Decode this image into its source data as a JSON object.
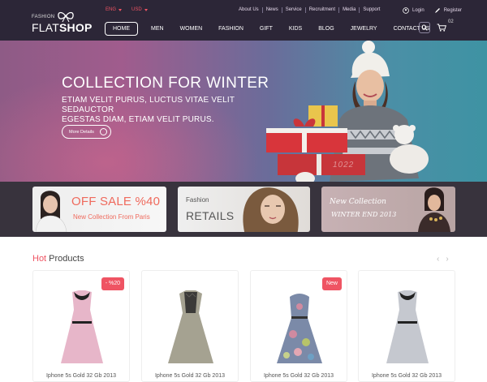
{
  "header": {
    "logo": {
      "small": "FASHION",
      "main_light": "FLAT",
      "main_bold": "SHOP"
    },
    "language": "ENG",
    "currency": "USD",
    "top_links": [
      "About Us",
      "News",
      "Service",
      "Recruitment",
      "Media",
      "Support"
    ],
    "account": {
      "login": "Login",
      "register": "Register"
    },
    "nav": [
      "HOME",
      "MEN",
      "WOMEN",
      "FASHION",
      "GIFT",
      "KIDS",
      "BLOG",
      "JEWELRY",
      "CONTACT US"
    ],
    "cart_count": "02"
  },
  "hero": {
    "title": "COLLECTION FOR WINTER",
    "subtitle_line1": "ETIAM VELIT PURUS, LUCTUS VITAE VELIT SEDAUCTOR",
    "subtitle_line2": "EGESTAS DIAM, ETIAM VELIT PURUS.",
    "button": "More Details",
    "watermark": "1022"
  },
  "promos": [
    {
      "title": "OFF SALE %40",
      "subtitle": "New Collection From Paris"
    },
    {
      "small": "Fashion",
      "big": "RETAILS"
    },
    {
      "line1": "New Collection",
      "line2": "WINTER END 2013"
    }
  ],
  "products": {
    "title_accent": "Hot",
    "title_rest": " Products",
    "items": [
      {
        "name": "Iphone 5s Gold 32 Gb 2013",
        "badge": "- %20",
        "color": "#e7b6c9"
      },
      {
        "name": "Iphone 5s Gold 32 Gb 2013",
        "badge": "",
        "color": "#a5a291"
      },
      {
        "name": "Iphone 5s Gold 32 Gb 2013",
        "badge": "New",
        "color": "#7b8aa8"
      },
      {
        "name": "Iphone 5s Gold 32 Gb 2013",
        "badge": "",
        "color": "#c5c8cf"
      }
    ]
  },
  "colors": {
    "accent": "#ef5463",
    "header_bg": "#2c2637"
  }
}
